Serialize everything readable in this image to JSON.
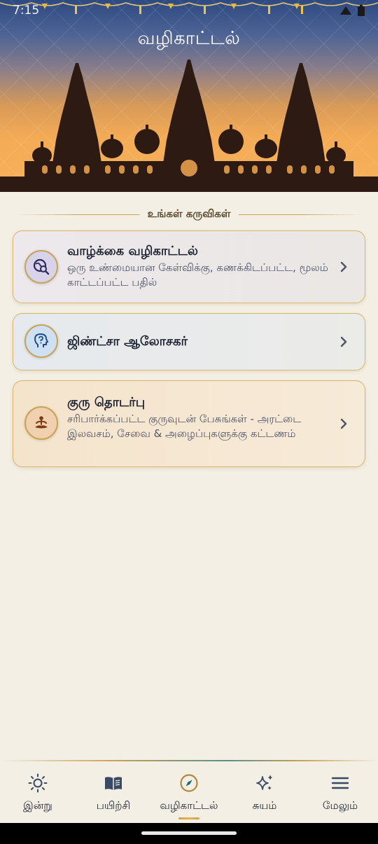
{
  "status_bar": {
    "time": "7:15"
  },
  "header": {
    "title": "வழிகாட்டல்"
  },
  "section": {
    "heading": "உங்கள் கருவிகள்"
  },
  "cards": [
    {
      "title": "வாழ்க்கை வழிகாட்டல்",
      "subtitle": "ஒரு உண்மையான கேள்விக்கு, கணக்கிடப்பட்ட, மூலம் காட்டப்பட்ட பதில்",
      "icon": "globe-search-icon"
    },
    {
      "title": "ஜிண்ட்சா ஆலோசகர்",
      "subtitle": "",
      "icon": "head-question-icon"
    },
    {
      "title": "குரு தொடர்பு",
      "subtitle": "சரிபார்க்கப்பட்ட குருவுடன் பேசுங்கள் - அரட்டை இலவசம், சேவை & அழைப்புகளுக்கு கட்டணம்",
      "icon": "meditation-icon"
    }
  ],
  "nav": [
    {
      "label": "இன்று",
      "icon": "sun-icon"
    },
    {
      "label": "பயிற்சி",
      "icon": "book-icon"
    },
    {
      "label": "வழிகாட்டல்",
      "icon": "compass-icon",
      "active": true
    },
    {
      "label": "சுயம்",
      "icon": "sparkles-icon"
    },
    {
      "label": "மேலும்",
      "icon": "menu-icon"
    }
  ],
  "colors": {
    "accent_gold": "#c8a35a",
    "background": "#f3efe4",
    "text": "#1e2333"
  }
}
